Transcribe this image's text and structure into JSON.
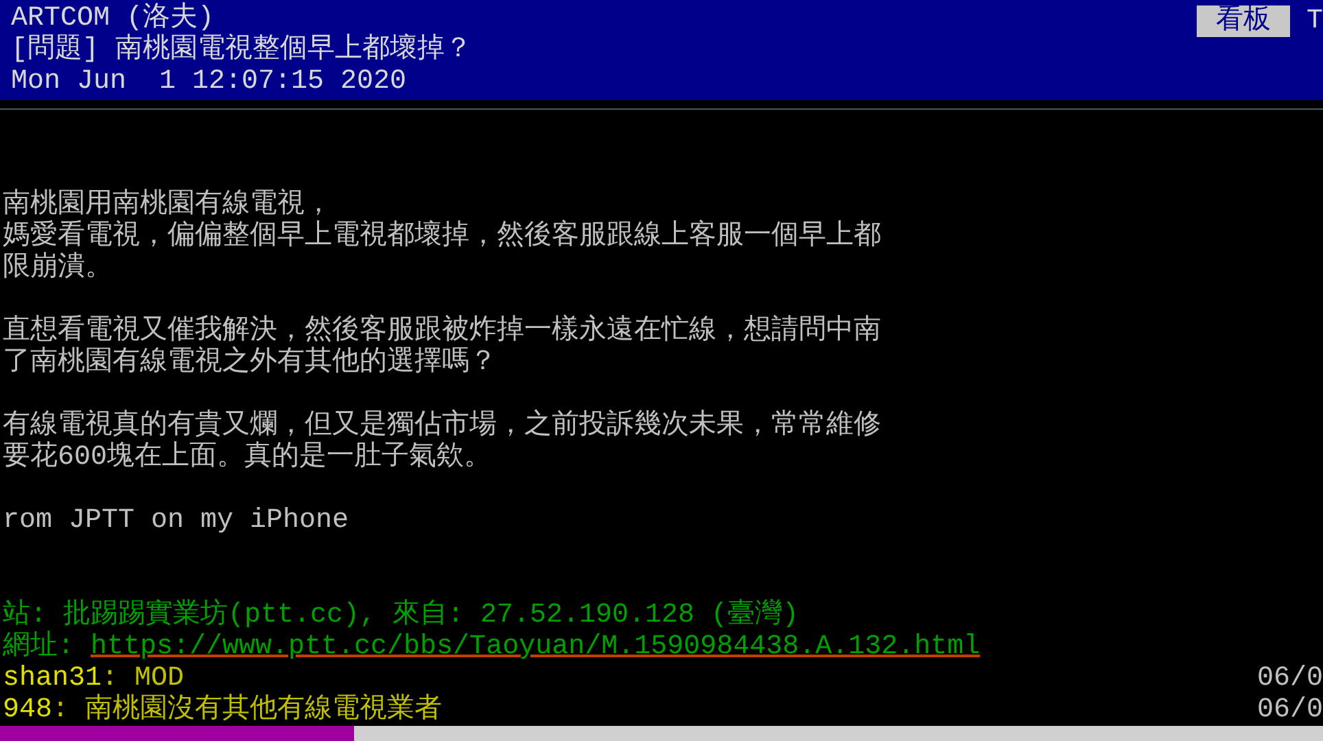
{
  "header": {
    "rows": [
      {
        "text": "ARTCOM (洛夫)"
      },
      {
        "text": "[問題] 南桃園電視整個早上都壞掉？"
      },
      {
        "text": "Mon Jun  1 12:07:15 2020"
      }
    ],
    "board_label": "看板",
    "board_name": "T"
  },
  "body": {
    "paragraphs": [
      [
        "南桃園用南桃園有線電視，",
        "媽愛看電視，偏偏整個早上電視都壞掉，然後客服跟線上客服一個早上都",
        "限崩潰。"
      ],
      [
        "直想看電視又催我解決，然後客服跟被炸掉一樣永遠在忙線，想請問中南",
        "了南桃園有線電視之外有其他的選擇嗎？"
      ],
      [
        "有線電視真的有貴又爛，但又是獨佔市場，之前投訴幾次未果，常常維修",
        "要花600塊在上面。真的是一肚子氣欸。"
      ],
      [
        "rom JPTT on my iPhone"
      ]
    ]
  },
  "footer": {
    "station": "站: 批踢踢實業坊(ptt.cc), 來自: 27.52.190.128 (臺灣)",
    "url_label": "網址: ",
    "url": "https://www.ptt.cc/bbs/Taoyuan/M.1590984438.A.132.html"
  },
  "pushes": [
    {
      "user": "shan31",
      "content": ": MOD",
      "time": "06/0"
    },
    {
      "user": "948",
      "content": ": 南桃園沒有其他有線電視業者",
      "time": "06/0"
    }
  ]
}
